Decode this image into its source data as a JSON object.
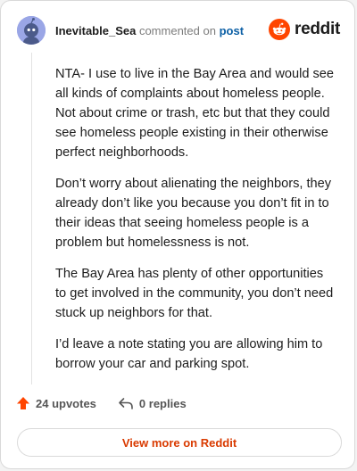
{
  "header": {
    "username": "Inevitable_Sea",
    "commented_on": "commented on",
    "post_link": "post",
    "brand": "reddit"
  },
  "comment": {
    "paragraphs": [
      "NTA- I use to live in the Bay Area and would see all kinds of complaints about homeless people. Not about crime or trash, etc but that they could see homeless people existing in their otherwise perfect neighborhoods.",
      "Don’t worry about alienating the neighbors, they already don’t like you because you don’t fit in to their ideas that seeing homeless people is a problem but homelessness is not.",
      "The Bay Area has plenty of other opportunities to get involved in the community, you don’t need stuck up neighbors for that.",
      "I’d leave a note stating you are allowing him to borrow your car and parking spot."
    ]
  },
  "actions": {
    "upvotes": "24 upvotes",
    "replies": "0 replies"
  },
  "footer": {
    "view_more": "View more on Reddit"
  },
  "colors": {
    "brand_orange": "#ff4500",
    "link_blue": "#0b5fa5",
    "view_more_text": "#d93a00"
  },
  "icons": [
    "avatar-snoo-icon",
    "reddit-logo-icon",
    "upvote-arrow-icon",
    "reply-arrow-icon"
  ]
}
